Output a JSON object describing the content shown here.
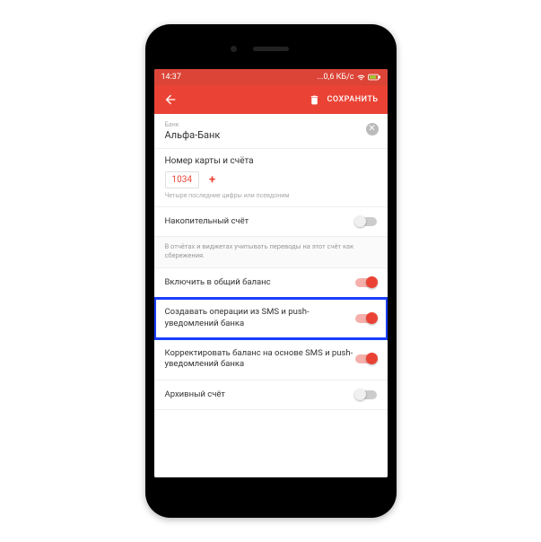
{
  "statusbar": {
    "time": "14:37",
    "network": "...0,6 КБ/с"
  },
  "appbar": {
    "save_label": "СОХРАНИТЬ"
  },
  "bank_field": {
    "label": "Банк",
    "value": "Альфа-Банк"
  },
  "card_section": {
    "title": "Номер карты и счёта",
    "chip": "1034",
    "helper": "Четыре последние цифры или псевдоним"
  },
  "rows": {
    "savings": {
      "label": "Накопительный счёт",
      "note": "В отчётах и виджетах учитывать переводы на этот счёт как сбережения."
    },
    "include_balance": {
      "label": "Включить в общий баланс"
    },
    "create_ops": {
      "label": "Создавать операции из SMS и push-уведомлений банка"
    },
    "correct_balance": {
      "label": "Корректировать баланс на основе SMS и push-уведомлений банка"
    },
    "archive": {
      "label": "Архивный счёт"
    }
  }
}
